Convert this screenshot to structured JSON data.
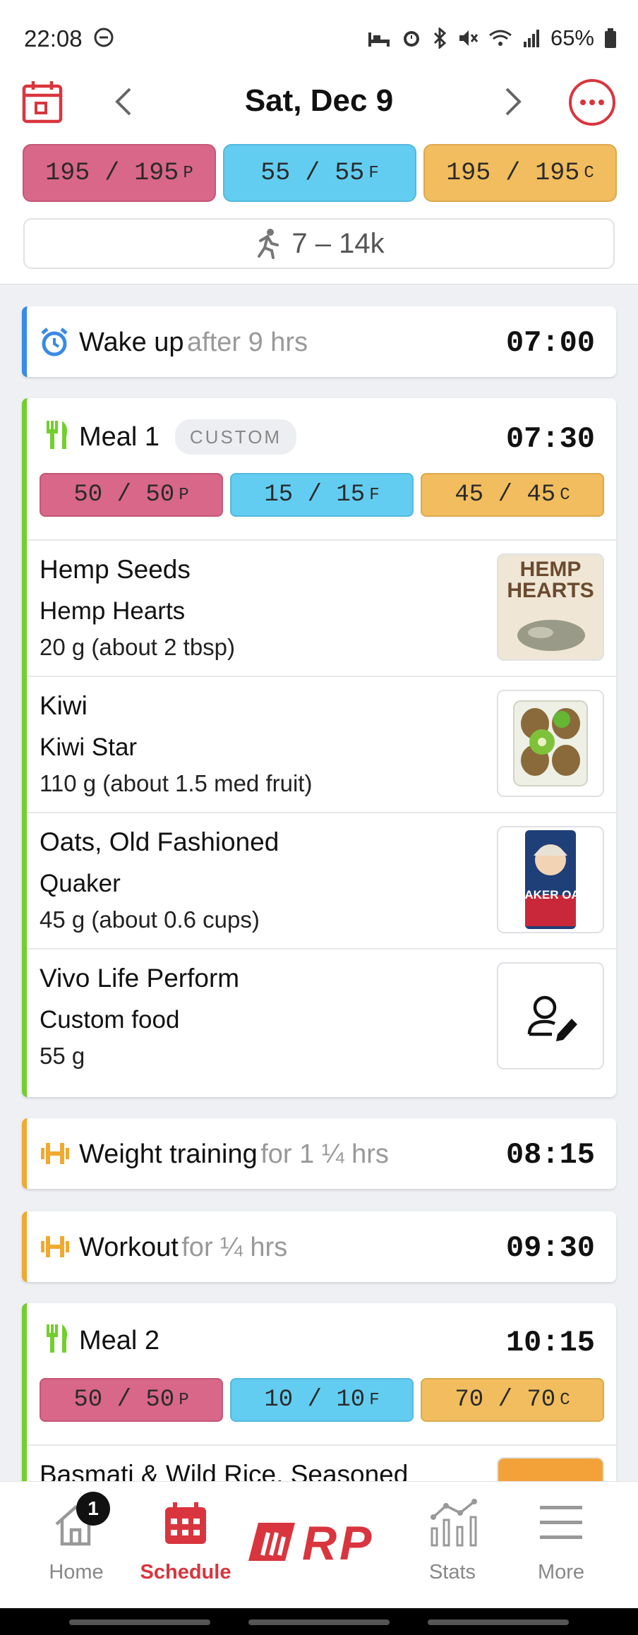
{
  "status_bar": {
    "time": "22:08",
    "battery": "65%"
  },
  "header": {
    "date": "Sat, Dec 9",
    "prev_icon": "chevron-left-icon",
    "next_icon": "chevron-right-icon"
  },
  "day_macros": {
    "protein": {
      "value": "195 / 195",
      "unit": "P"
    },
    "fat": {
      "value": "55 / 55",
      "unit": "F"
    },
    "carbs": {
      "value": "195 / 195",
      "unit": "C"
    }
  },
  "steps": "7 – 14k",
  "events": {
    "wake": {
      "title": "Wake up",
      "sub": "after 9 hrs",
      "time": "07:00"
    },
    "meal1": {
      "title": "Meal 1",
      "badge": "CUSTOM",
      "time": "07:30",
      "macros": {
        "p": "50 / 50",
        "f": "15 / 15",
        "c": "45 / 45"
      },
      "foods": [
        {
          "name": "Hemp Seeds",
          "brand": "Hemp Hearts",
          "amount": "20 g (about 2 tbsp)",
          "thumb_text": "HEMP HEARTS"
        },
        {
          "name": "Kiwi",
          "brand": "Kiwi Star",
          "amount": "110 g (about 1.5 med fruit)"
        },
        {
          "name": "Oats, Old Fashioned",
          "brand": "Quaker",
          "amount": "45 g (about 0.6 cups)",
          "thumb_text": "QUAKER OATS"
        },
        {
          "name": "Vivo Life Perform",
          "brand": "Custom food",
          "amount": "55 g"
        }
      ]
    },
    "weight": {
      "title": "Weight training",
      "sub": "for 1 ¼ hrs",
      "time": "08:15"
    },
    "workout": {
      "title": "Workout",
      "sub": "for ¼ hrs",
      "time": "09:30"
    },
    "meal2": {
      "title": "Meal 2",
      "time": "10:15",
      "macros": {
        "p": "50 / 50",
        "f": "10 / 10",
        "c": "70 / 70"
      },
      "foods": [
        {
          "name": "Basmati & Wild Rice, Seasoned"
        }
      ]
    }
  },
  "nav": {
    "home": "Home",
    "home_badge": "1",
    "schedule": "Schedule",
    "logo": "RP",
    "stats": "Stats",
    "more": "More"
  },
  "colors": {
    "accent": "#d9353e",
    "protein": "#d8678a",
    "fat": "#63cdf1",
    "carbs": "#f1bd5e"
  }
}
